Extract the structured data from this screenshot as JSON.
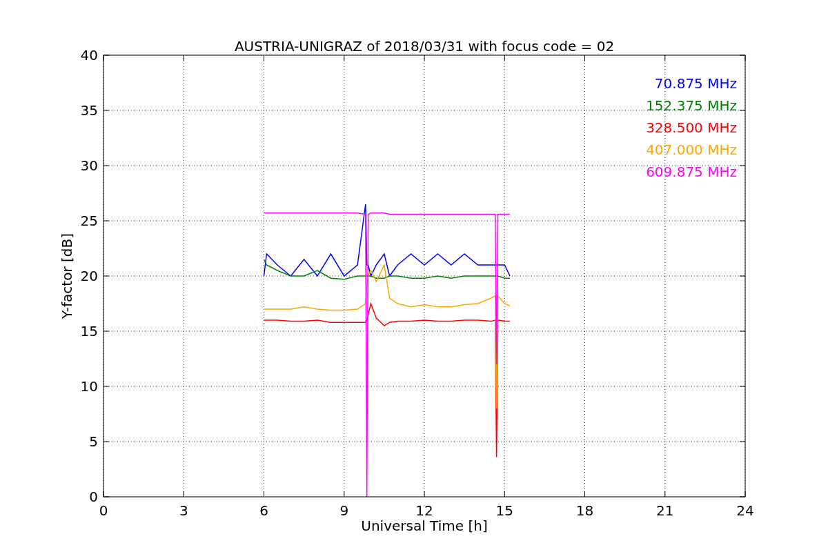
{
  "chart": {
    "chart_data": {
      "type": "line",
      "title": "AUSTRIA-UNIGRAZ of 2018/03/31 with focus code = 02",
      "xlabel": "Universal Time [h]",
      "ylabel": "Y-factor [dB]",
      "x": [
        6,
        6.1,
        6.5,
        7,
        7.5,
        8,
        8.5,
        9,
        9.5,
        9.8,
        9.85,
        9.9,
        10,
        10.2,
        10.5,
        10.7,
        11,
        11.5,
        12,
        12.5,
        13,
        13.5,
        14,
        14.5,
        14.65,
        14.7,
        14.75,
        15,
        15.2
      ],
      "series": [
        {
          "name": "70.875 MHz",
          "color": "#0000ff",
          "values": [
            20,
            22,
            21,
            20,
            21.5,
            20,
            22,
            20,
            21,
            26.5,
            21,
            21,
            20,
            21,
            22,
            20,
            21,
            22,
            21,
            22,
            21,
            22,
            21,
            21,
            21,
            21,
            21,
            21,
            20
          ]
        },
        {
          "name": "152.375 MHz",
          "color": "#008000",
          "values": [
            21.5,
            21,
            20.5,
            20,
            20,
            20.5,
            19.8,
            19.7,
            20,
            20,
            20,
            20,
            20,
            19.8,
            19.8,
            20,
            20,
            19.8,
            19.8,
            20,
            19.8,
            20,
            20,
            20,
            20,
            20,
            20,
            19.8,
            19.8
          ]
        },
        {
          "name": "328.500 MHz",
          "color": "#ff0000",
          "values": [
            16,
            16,
            16,
            15.9,
            15.9,
            16,
            15.8,
            15.8,
            15.8,
            15.8,
            16,
            16.5,
            17.5,
            16.2,
            15.5,
            15.8,
            15.9,
            15.9,
            16,
            15.9,
            15.9,
            16,
            16,
            15.9,
            16,
            3.6,
            16,
            15.9,
            15.9
          ]
        },
        {
          "name": "407.000 MHz",
          "color": "#ffa500",
          "values": [
            17,
            17,
            17,
            17,
            17.2,
            17,
            16.9,
            16.9,
            17,
            17.5,
            19,
            20,
            20.5,
            19.5,
            21,
            18,
            17.5,
            17.2,
            17.4,
            17.2,
            17.2,
            17.4,
            17.5,
            18,
            18.2,
            8,
            18.2,
            17.5,
            17.3
          ]
        },
        {
          "name": "609.875 MHz",
          "color": "#ff00ff",
          "values": [
            25.7,
            25.7,
            25.7,
            25.7,
            25.7,
            25.7,
            25.7,
            25.7,
            25.7,
            25.6,
            0,
            25.6,
            25.7,
            25.7,
            25.7,
            25.6,
            25.6,
            25.6,
            25.6,
            25.6,
            25.6,
            25.6,
            25.6,
            25.6,
            25.6,
            12,
            25.6,
            25.6,
            25.6
          ]
        }
      ],
      "grid": true,
      "xlim": [
        0,
        24
      ],
      "ylim": [
        0,
        40
      ],
      "xticks": [
        0,
        3,
        6,
        9,
        12,
        15,
        18,
        21,
        24
      ],
      "yticks": [
        0,
        5,
        10,
        15,
        20,
        25,
        30,
        35,
        40
      ]
    }
  }
}
